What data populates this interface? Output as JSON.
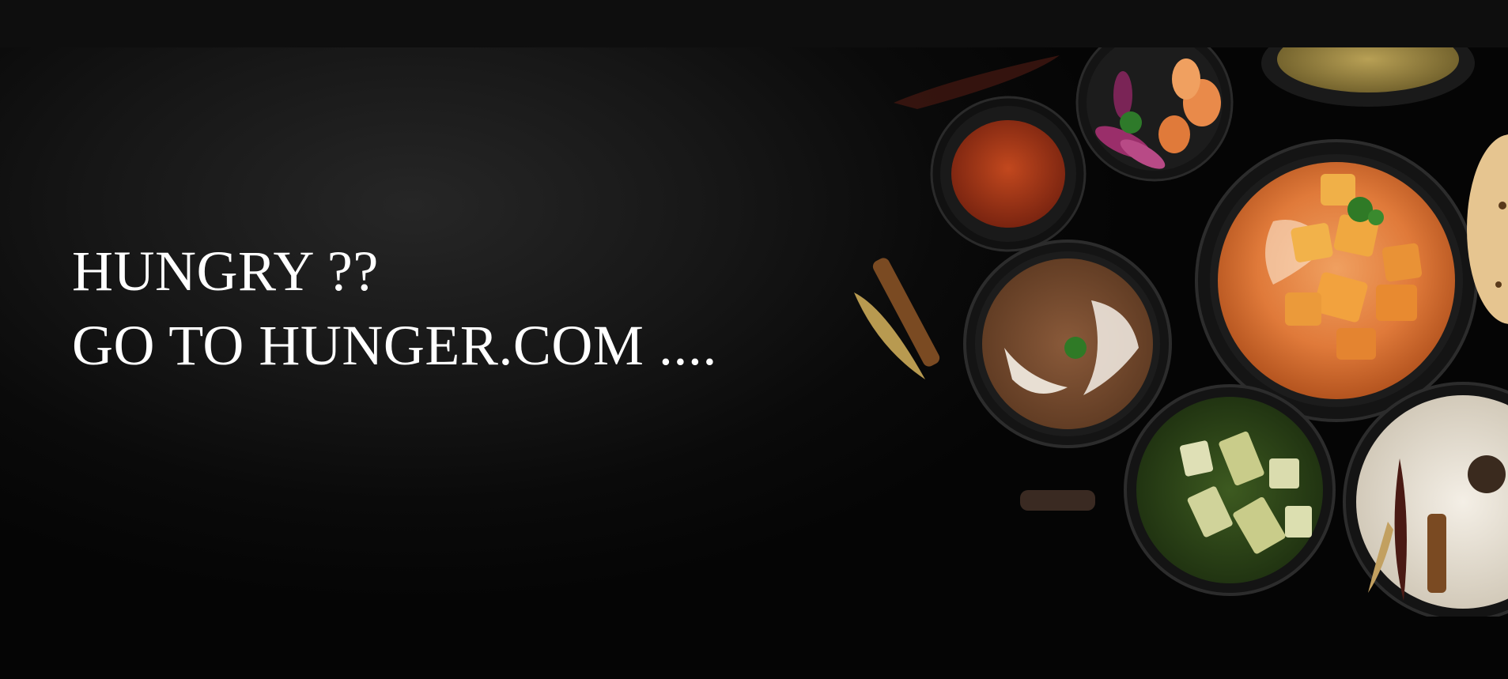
{
  "hero": {
    "line1": "HUNGRY ??",
    "line2": "GO TO HUNGER.COM ...."
  },
  "colors": {
    "background": "#050505",
    "top_bar": "#0e0e0e",
    "text": "#ffffff"
  }
}
